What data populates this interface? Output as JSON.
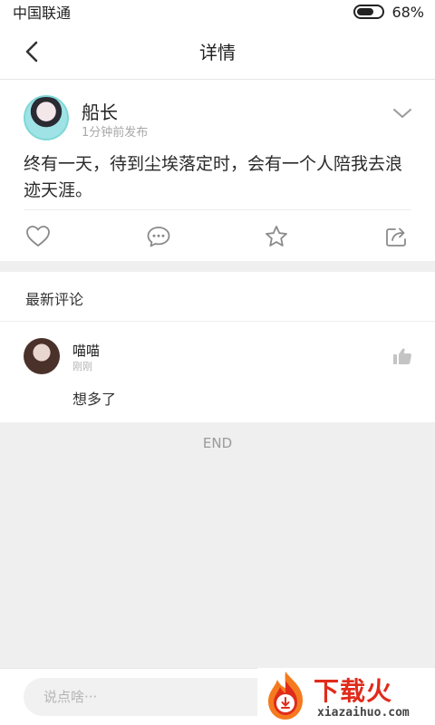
{
  "status_bar": {
    "carrier": "中国联通",
    "battery_percent_label": "68%",
    "battery_level": 0.68,
    "icons": [
      "battery-icon"
    ]
  },
  "header": {
    "title": "详情",
    "back_icon": "chevron-left-icon"
  },
  "post": {
    "author": "船长",
    "time": "1分钟前发布",
    "content": "终有一天，待到尘埃落定时，会有一个人陪我去浪迹天涯。",
    "expand_icon": "chevron-down-icon",
    "actions": [
      "heart-icon",
      "comment-icon",
      "star-icon",
      "share-icon"
    ]
  },
  "comments": {
    "section_title": "最新评论",
    "items": [
      {
        "author": "喵喵",
        "time": "刚刚",
        "text": "想多了",
        "like_icon": "thumbs-up-icon"
      }
    ]
  },
  "end_label": "END",
  "bottom_bar": {
    "input_placeholder": "说点啥···"
  },
  "watermark": {
    "main": "下载火",
    "sub": "xiazaihuo.com"
  },
  "colors": {
    "brand_red": "#e02b1b",
    "icon_gray": "#8a8a8a",
    "background": "#efefef"
  }
}
